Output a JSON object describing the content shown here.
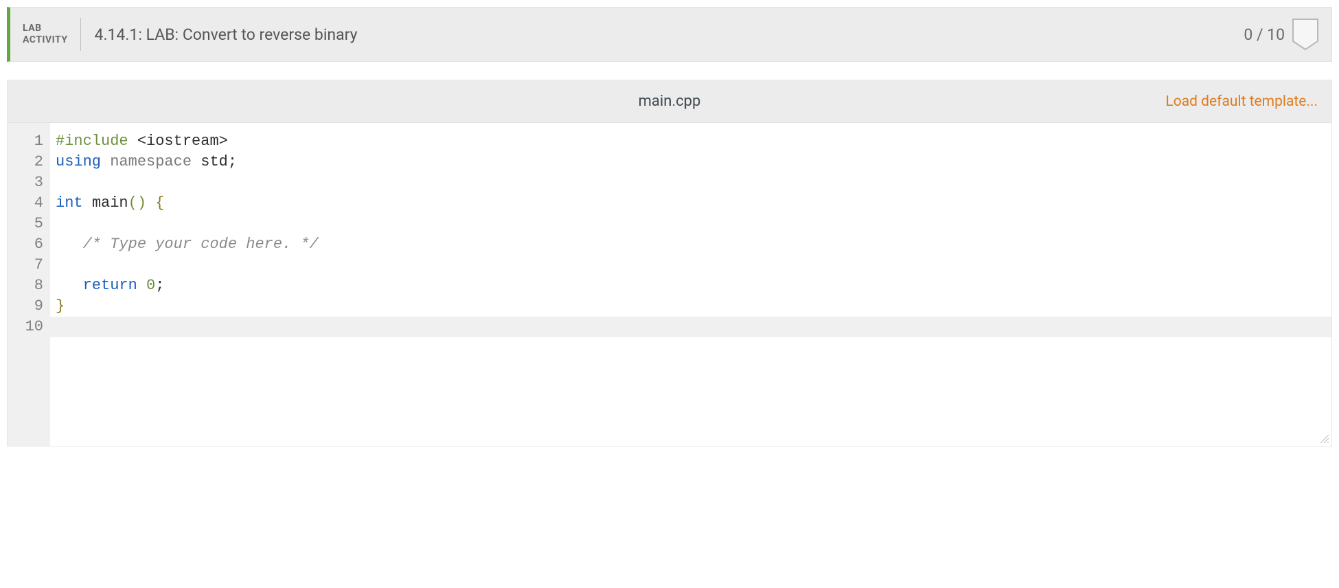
{
  "header": {
    "label_line1": "LAB",
    "label_line2": "ACTIVITY",
    "title": "4.14.1: LAB: Convert to reverse binary",
    "score": "0 / 10"
  },
  "editor": {
    "filename": "main.cpp",
    "load_default_label": "Load default template...",
    "active_line_index": 9,
    "lines": [
      {
        "n": "1",
        "tokens": [
          {
            "cls": "tok-pp",
            "t": "#include "
          },
          {
            "cls": "tok-str",
            "t": "<iostream>"
          }
        ]
      },
      {
        "n": "2",
        "tokens": [
          {
            "cls": "tok-kw",
            "t": "using "
          },
          {
            "cls": "tok-ns",
            "t": "namespace "
          },
          {
            "cls": "tok-id",
            "t": "std"
          },
          {
            "cls": "tok-punc",
            "t": ";"
          }
        ]
      },
      {
        "n": "3",
        "tokens": []
      },
      {
        "n": "4",
        "tokens": [
          {
            "cls": "tok-kw",
            "t": "int "
          },
          {
            "cls": "tok-id",
            "t": "main"
          },
          {
            "cls": "tok-par",
            "t": "()"
          },
          {
            "cls": "tok-id",
            "t": " "
          },
          {
            "cls": "tok-brc",
            "t": "{"
          }
        ]
      },
      {
        "n": "5",
        "tokens": []
      },
      {
        "n": "6",
        "tokens": [
          {
            "cls": "tok-id",
            "t": "   "
          },
          {
            "cls": "tok-cmt",
            "t": "/* Type your code here. */"
          }
        ]
      },
      {
        "n": "7",
        "tokens": []
      },
      {
        "n": "8",
        "tokens": [
          {
            "cls": "tok-id",
            "t": "   "
          },
          {
            "cls": "tok-kw",
            "t": "return "
          },
          {
            "cls": "tok-num",
            "t": "0"
          },
          {
            "cls": "tok-punc",
            "t": ";"
          }
        ]
      },
      {
        "n": "9",
        "tokens": [
          {
            "cls": "tok-brc",
            "t": "}"
          }
        ]
      },
      {
        "n": "10",
        "tokens": []
      }
    ]
  }
}
